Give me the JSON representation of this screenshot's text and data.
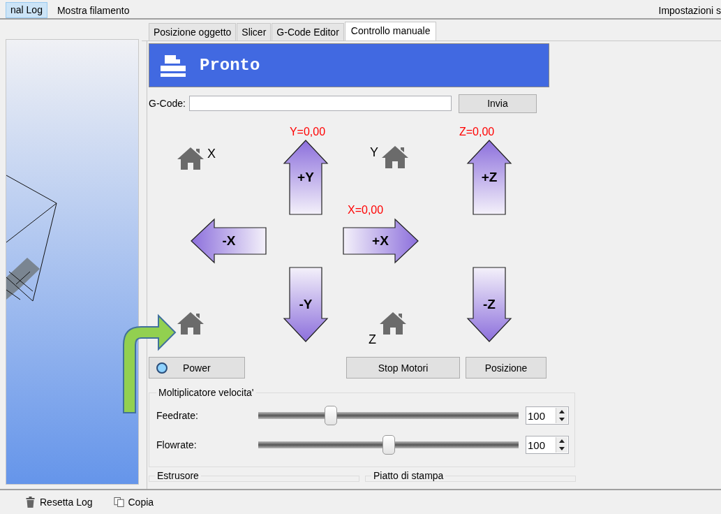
{
  "menu_bar": {
    "items": [
      {
        "label": "nal Log",
        "selected": true
      },
      {
        "label": "Mostra filamento",
        "selected": false
      }
    ],
    "right_label": "Impostazioni s"
  },
  "tabs": [
    {
      "label": "Posizione oggetto",
      "selected": false
    },
    {
      "label": "Slicer",
      "selected": false
    },
    {
      "label": "G-Code Editor",
      "selected": false
    },
    {
      "label": "Controllo manuale",
      "selected": true
    }
  ],
  "status": {
    "title": "Pronto"
  },
  "gcode": {
    "label": "G-Code:",
    "button": "Invia"
  },
  "readouts": {
    "y": "Y=0,00",
    "z": "Z=0,00",
    "x": "X=0,00"
  },
  "home_labels": {
    "x": "X",
    "y": "Y",
    "z": "Z"
  },
  "jog_buttons": [
    {
      "label": "+Y",
      "kind": "up"
    },
    {
      "label": "+Z",
      "kind": "up"
    },
    {
      "label": "-X",
      "kind": "left"
    },
    {
      "label": "+X",
      "kind": "right"
    },
    {
      "label": "-Y",
      "kind": "down"
    },
    {
      "label": "-Z",
      "kind": "down"
    }
  ],
  "power": {
    "label": "Power",
    "led_on": true
  },
  "buttons": [
    "Stop Motori",
    "Posizione"
  ],
  "speed": {
    "title": "Moltiplicatore velocita'",
    "rows": [
      {
        "label": "Feedrate:",
        "level": 0.28,
        "value": "100"
      },
      {
        "label": "Flowrate:",
        "level": 0.5,
        "value": "100"
      }
    ]
  },
  "groups": [
    "Estrusore",
    "Piatto di stampa"
  ],
  "log_toolbar": [
    {
      "label": "Resetta Log",
      "kind": "trash"
    },
    {
      "label": "Copia",
      "kind": "copy"
    }
  ]
}
